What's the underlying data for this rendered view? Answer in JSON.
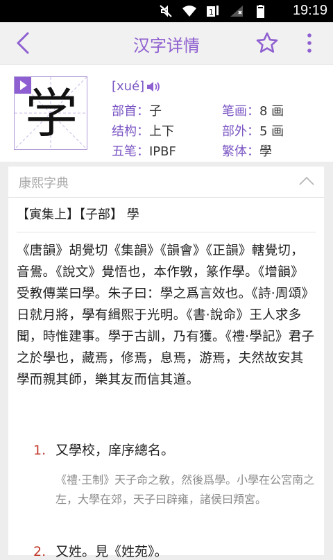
{
  "status_bar": {
    "time": "19:19"
  },
  "toolbar": {
    "title": "汉字详情"
  },
  "character": {
    "glyph": "学",
    "pinyin": "[xué]",
    "fields": [
      {
        "label": "部首：",
        "value": "子"
      },
      {
        "label": "笔画：",
        "value": "8 画"
      },
      {
        "label": "结构：",
        "value": "上下"
      },
      {
        "label": "部外：",
        "value": "5 画"
      },
      {
        "label": "五笔：",
        "value": "IPBF"
      },
      {
        "label": "繁体：",
        "value": "學"
      }
    ]
  },
  "kangxi": {
    "title": "康熙字典",
    "subheading": "【寅集上】【子部】 學",
    "body": "《唐韻》胡覺切《集韻》《韻會》《正韻》轄覺切，音鷽。《說文》覺悟也，本作斆，篆作學。《增韻》受教傳業曰學。朱子曰：學之爲言效也。《詩·周頌》日就月將，學有緝熙于光明。《書·說命》王人求多聞，時惟建事。學于古訓，乃有獲。《禮·學記》君子之於學也，藏焉，修焉，息焉，游焉，夫然故安其學而親其師，樂其友而信其道。",
    "definitions": [
      {
        "num": "1.",
        "text": "又學校，庠序總名。",
        "quote": "《禮·王制》天子命之敎，然後爲學。小學在公宮南之左，大學在郊，天子曰辟雍，諸侯曰頖宮。"
      },
      {
        "num": "2.",
        "text": "又姓。見《姓苑》。"
      }
    ]
  },
  "colors": {
    "accent": "#8e5fd0",
    "number": "#c0392b"
  }
}
